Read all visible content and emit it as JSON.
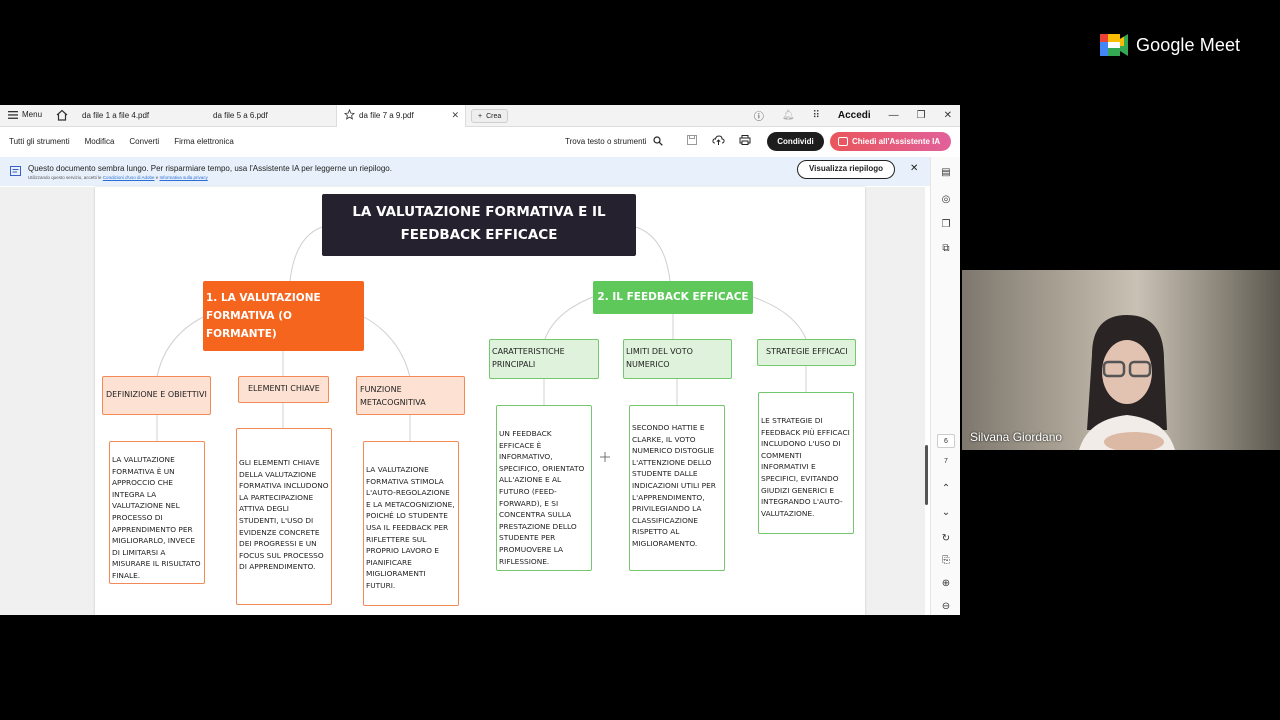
{
  "meet": {
    "brand": "Google Meet",
    "participant_name": "Silvana Giordano"
  },
  "tabs": {
    "menu_label": "Menu",
    "items": [
      {
        "label": "da file 1 a file 4.pdf"
      },
      {
        "label": "da file 5 a 6.pdf"
      },
      {
        "label": "da file 7 a 9.pdf"
      }
    ],
    "new_label": "Crea",
    "sign_in": "Accedi"
  },
  "toolbar": {
    "all_tools": "Tutti gli strumenti",
    "edit": "Modifica",
    "convert": "Converti",
    "sign": "Firma elettronica",
    "find": "Trova testo o strumenti",
    "share": "Condividi",
    "ai_assistant": "Chiedi all'Assistente IA"
  },
  "banner": {
    "message": "Questo documento sembra lungo. Per risparmiare tempo, usa l'Assistente IA per leggerne un riepilogo.",
    "sub_prefix": "Utilizzando questo servizio, accetti le",
    "sub_link1": "Condizioni d'uso di Adobe",
    "sub_mid": "e",
    "sub_link2": "Informativa sulla privacy",
    "summary_button": "Visualizza riepilogo"
  },
  "sidebar": {
    "pages": [
      "6",
      "7"
    ]
  },
  "mindmap": {
    "title": "LA VALUTAZIONE FORMATIVA E IL FEEDBACK EFFICACE",
    "branch1": {
      "label": "1. LA VALUTAZIONE FORMATIVA (O FORMANTE)",
      "subs": [
        {
          "label": "DEFINIZIONE E OBIETTIVI",
          "text": "LA VALUTAZIONE FORMATIVA È UN APPROCCIO CHE INTEGRA LA VALUTAZIONE NEL PROCESSO DI APPRENDIMENTO PER MIGLIORARLO, INVECE DI LIMITARSI A MISURARE IL RISULTATO FINALE."
        },
        {
          "label": "ELEMENTI CHIAVE",
          "text": "GLI ELEMENTI CHIAVE DELLA VALUTAZIONE FORMATIVA INCLUDONO LA PARTECIPAZIONE ATTIVA DEGLI STUDENTI, L'USO DI EVIDENZE CONCRETE DEI PROGRESSI E UN FOCUS SUL PROCESSO DI APPRENDIMENTO."
        },
        {
          "label": "FUNZIONE METACOGNITIVA",
          "text": "LA VALUTAZIONE FORMATIVA STIMOLA L'AUTO-REGOLAZIONE E LA METACOGNIZIONE, POICHÉ LO STUDENTE USA IL FEEDBACK PER RIFLETTERE SUL PROPRIO LAVORO E PIANIFICARE MIGLIORAMENTI FUTURI."
        }
      ]
    },
    "branch2": {
      "label": "2. IL FEEDBACK EFFICACE",
      "subs": [
        {
          "label": "CARATTERISTICHE PRINCIPALI",
          "text": "UN FEEDBACK EFFICACE È INFORMATIVO, SPECIFICO, ORIENTATO ALL'AZIONE E AL FUTURO (FEED-FORWARD), E SI CONCENTRA SULLA PRESTAZIONE DELLO STUDENTE PER PROMUOVERE LA RIFLESSIONE."
        },
        {
          "label": "LIMITI DEL VOTO NUMERICO",
          "text": "SECONDO HATTIE E CLARKE, IL VOTO NUMERICO DISTOGLIE L'ATTENZIONE DELLO STUDENTE DALLE INDICAZIONI UTILI PER L'APPRENDIMENTO, PRIVILEGIANDO LA CLASSIFICAZIONE RISPETTO AL MIGLIORAMENTO."
        },
        {
          "label": "STRATEGIE EFFICACI",
          "text": "LE STRATEGIE DI FEEDBACK PIÙ EFFICACI INCLUDONO L'USO DI COMMENTI INFORMATIVI E SPECIFICI, EVITANDO GIUDIZI GENERICI E INTEGRANDO L'AUTO-VALUTAZIONE."
        }
      ]
    }
  }
}
